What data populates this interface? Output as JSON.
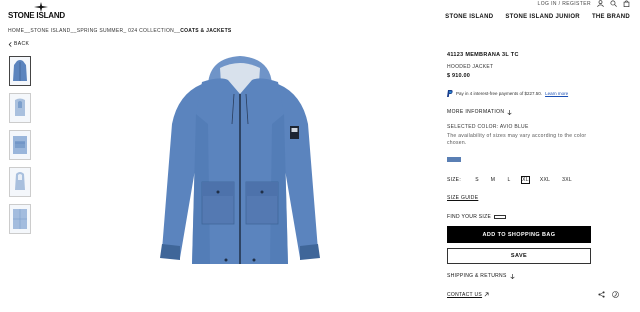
{
  "brand": {
    "name": "STONE ISLAND"
  },
  "topbar": {
    "login": "LOG IN / REGISTER",
    "icons": [
      "user-icon",
      "search-icon",
      "bag-icon"
    ]
  },
  "nav": [
    "STONE ISLAND",
    "STONE ISLAND JUNIOR",
    "THE BRAND"
  ],
  "breadcrumb": {
    "path": "HOME__STONE ISLAND__SPRING SUMMER_ 024 COLLECTION__",
    "current": "COATS & JACKETS"
  },
  "back": {
    "label": "BACK"
  },
  "product": {
    "name": "41123 MEMBRANA 3L TC",
    "type": "HOODED JACKET",
    "price": "$ 910.00",
    "paypal_text": "Pay in 4 interest-free payments of $227.50.",
    "paypal_link": "Learn more",
    "more_info": "MORE INFORMATION",
    "selected_color": "SELECTED COLOR: AVIO BLUE",
    "availability_note": "The availability of sizes may vary according to the color chosen.",
    "swatch_color": "#5a7fb4",
    "sizes_label": "SIZE:",
    "sizes": [
      "S",
      "M",
      "L",
      "XL",
      "XXL",
      "3XL"
    ],
    "selected_size": "XL",
    "size_guide": "SIZE GUIDE",
    "find_size": "FIND YOUR SIZE",
    "add_to_bag": "ADD TO SHOPPING BAG",
    "save": "SAVE",
    "shipping": "SHIPPING & RETURNS",
    "contact": "CONTACT US"
  },
  "colors": {
    "jacket": "#5b84be",
    "jacket_dark": "#3f6699",
    "button_bg": "#000000"
  }
}
